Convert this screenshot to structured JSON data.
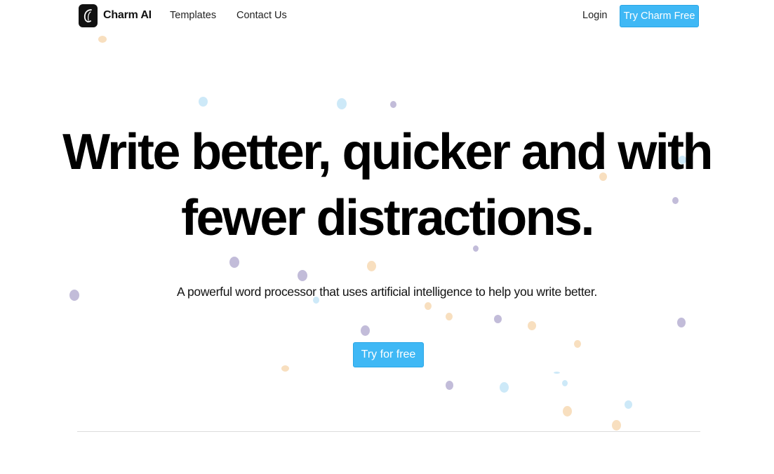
{
  "nav": {
    "brand": "Charm AI",
    "links": [
      "Templates",
      "Contact Us"
    ],
    "login": "Login",
    "cta": "Try Charm Free"
  },
  "hero": {
    "headline_line1": "Write better, quicker and with",
    "headline_line2": "fewer distractions.",
    "subheadline": "A powerful word processor that uses artificial intelligence to help you write better.",
    "cta": "Try for free"
  },
  "colors": {
    "accent": "#3fb8f5",
    "dot_purple": "#c2bcd9",
    "dot_blue": "#cde9f8",
    "dot_orange": "#f8dfbf"
  },
  "icons": {
    "logo": "charm-logo-icon"
  }
}
